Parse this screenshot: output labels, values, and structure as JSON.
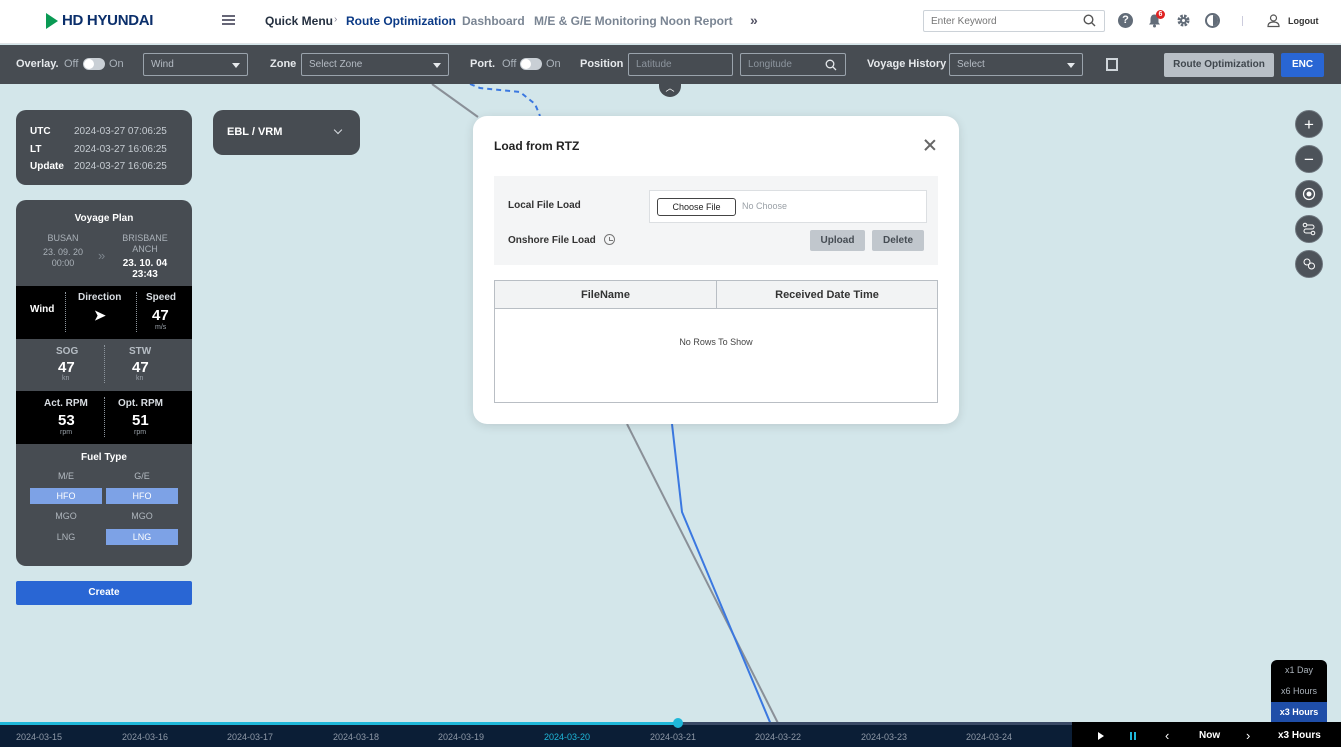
{
  "header": {
    "logo_text": "HD HYUNDAI",
    "nav": {
      "quick_menu": "Quick Menu",
      "route_optimization": "Route Optimization",
      "dashboard": "Dashboard",
      "me_ge": "M/E & G/E Monitoring",
      "noon_report": "Noon Report",
      "more": "»"
    },
    "search_placeholder": "Enter Keyword",
    "notification_count": "6",
    "logout": "Logout"
  },
  "toolbar": {
    "overlay_label": "Overlay.",
    "overlay_off": "Off",
    "overlay_on": "On",
    "overlay_select": "Wind",
    "zone_label": "Zone",
    "zone_placeholder": "Select Zone",
    "port_label": "Port.",
    "port_off": "Off",
    "port_on": "On",
    "position_label": "Position",
    "latitude_placeholder": "Latitude",
    "longitude_placeholder": "Longitude",
    "voyage_history_label": "Voyage History",
    "voyage_history_placeholder": "Select",
    "route_optimization_button": "Route Optimization",
    "enc_button": "ENC"
  },
  "time_panel": {
    "utc_label": "UTC",
    "utc_value": "2024-03-27 07:06:25",
    "lt_label": "LT",
    "lt_value": "2024-03-27 16:06:25",
    "update_label": "Update",
    "update_value": "2024-03-27 16:06:25"
  },
  "ebl": {
    "label": "EBL / VRM"
  },
  "voyage_plan": {
    "title": "Voyage Plan",
    "from_port": "BUSAN",
    "from_date": "23. 09. 20",
    "from_time": "00:00",
    "to_port_line1": "BRISBANE",
    "to_port_line2": "ANCH",
    "to_date": "23. 10. 04",
    "to_time": "23:43",
    "wind_label": "Wind",
    "direction_label": "Direction",
    "direction_arrow": "➤",
    "speed_label": "Speed",
    "speed_value": "47",
    "speed_unit": "m/s",
    "sog_label": "SOG",
    "sog_value": "47",
    "sog_unit": "kn",
    "stw_label": "STW",
    "stw_value": "47",
    "stw_unit": "kn",
    "act_rpm_label": "Act. RPM",
    "act_rpm_value": "53",
    "act_rpm_unit": "rpm",
    "opt_rpm_label": "Opt. RPM",
    "opt_rpm_value": "51",
    "opt_rpm_unit": "rpm",
    "fuel_title": "Fuel Type",
    "me_label": "M/E",
    "ge_label": "G/E",
    "me_hfo": "HFO",
    "ge_hfo": "HFO",
    "me_mgo": "MGO",
    "ge_mgo": "MGO",
    "me_lng": "LNG",
    "ge_lng": "LNG",
    "create_button": "Create"
  },
  "map_controls": {
    "zoom_in": "+",
    "zoom_out": "−"
  },
  "modal": {
    "title": "Load from RTZ",
    "local_file_label": "Local File Load",
    "choose_file": "Choose File",
    "no_choose": "No Choose",
    "onshore_label": "Onshore File Load",
    "upload": "Upload",
    "delete": "Delete",
    "col_filename": "FileName",
    "col_received": "Received Date Time",
    "empty_text": "No Rows To Show"
  },
  "timeline": {
    "dates": [
      "2024-03-15",
      "2024-03-16",
      "2024-03-17",
      "2024-03-18",
      "2024-03-19",
      "2024-03-20",
      "2024-03-21",
      "2024-03-22",
      "2024-03-23",
      "2024-03-24"
    ],
    "active_date": "2024-03-20",
    "prev": "‹",
    "now": "Now",
    "next": "›",
    "speed_current": "x3 Hours",
    "speed_options": [
      "x1 Day",
      "x6 Hours",
      "x3 Hours"
    ]
  },
  "colors": {
    "accent_blue": "#2966d4",
    "route_blue": "#3b78e0",
    "route_gray": "#8a9098",
    "timeline_cyan": "#1fb7d9",
    "badge_red": "#e02222"
  }
}
